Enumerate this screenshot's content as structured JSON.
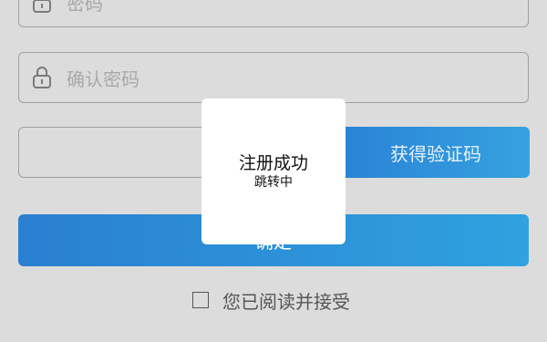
{
  "form": {
    "password_placeholder": "密码",
    "confirm_placeholder": "确认密码",
    "code_placeholder": "",
    "get_code_label": "获得验证码",
    "submit_label": "确定",
    "agree_label": "您已阅读并接受",
    "agree_checked": false
  },
  "toast": {
    "title": "注册成功",
    "subtitle": "跳转中"
  },
  "colors": {
    "background": "#dcdcdc",
    "accent": "#2a8ad8",
    "toast_bg": "#ffffff"
  },
  "icons": {
    "password": "lock-icon",
    "confirm": "lock-icon",
    "agree": "checkbox-icon"
  }
}
